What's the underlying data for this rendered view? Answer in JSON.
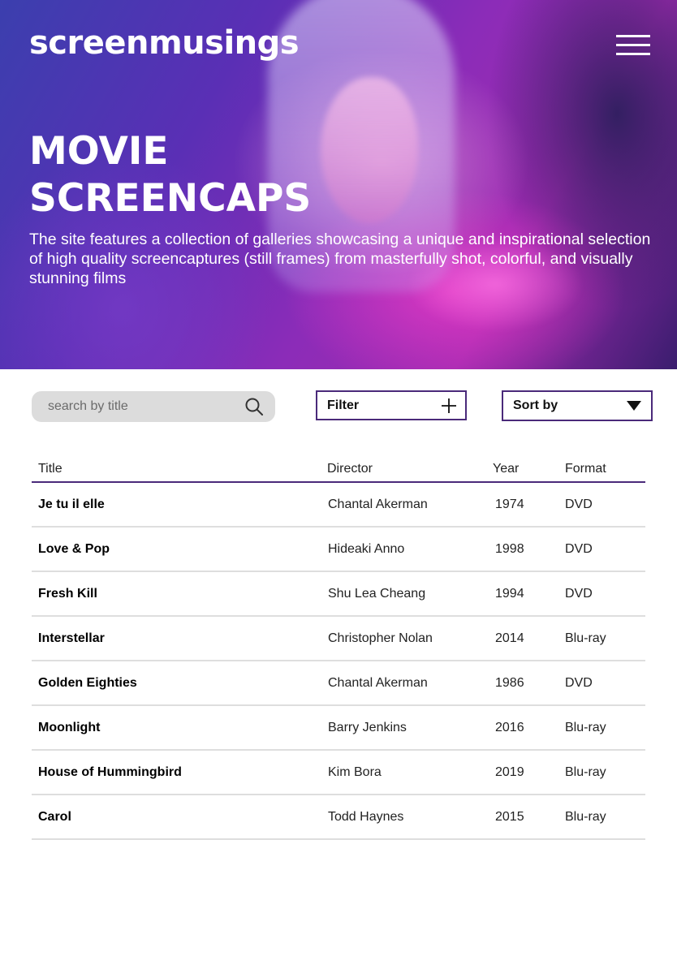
{
  "header": {
    "brand": "screenmusings",
    "menu_icon": "hamburger-menu-icon"
  },
  "hero": {
    "title": "MOVIE SCREENCAPS",
    "description": "The site features a collection of galleries showcasing a unique and inspirational selection of high quality screencaptures (still frames) from masterfully shot, colorful, and visually stunning films"
  },
  "controls": {
    "search": {
      "placeholder": "search by title",
      "value": "",
      "icon": "search-icon"
    },
    "filter": {
      "label": "Filter",
      "icon": "plus-icon"
    },
    "sort": {
      "label": "Sort by",
      "icon": "caret-down-icon"
    }
  },
  "table": {
    "columns": [
      "Title",
      "Director",
      "Year",
      "Format"
    ],
    "rows": [
      [
        "Je tu il elle",
        "Chantal Akerman",
        "1974",
        "DVD"
      ],
      [
        "Love & Pop",
        "Hideaki Anno",
        "1998",
        "DVD"
      ],
      [
        "Fresh Kill",
        "Shu Lea Cheang",
        "1994",
        "DVD"
      ],
      [
        "Interstellar",
        "Christopher Nolan",
        "2014",
        "Blu-ray"
      ],
      [
        "Golden Eighties",
        "Chantal Akerman",
        "1986",
        "DVD"
      ],
      [
        "Moonlight",
        "Barry Jenkins",
        "2016",
        "Blu-ray"
      ],
      [
        "House of Hummingbird",
        "Kim Bora",
        "2019",
        "Blu-ray"
      ],
      [
        "Carol",
        "Todd Haynes",
        "2015",
        "Blu-ray"
      ]
    ]
  },
  "colors": {
    "accent": "#4a2a7a",
    "search_bg": "#dcdcdc",
    "row_divider": "#dedede"
  }
}
